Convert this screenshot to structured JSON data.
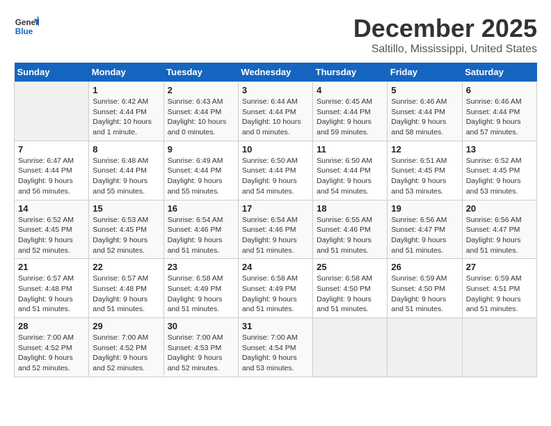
{
  "logo": {
    "line1": "General",
    "line2": "Blue"
  },
  "title": "December 2025",
  "subtitle": "Saltillo, Mississippi, United States",
  "days_header": [
    "Sunday",
    "Monday",
    "Tuesday",
    "Wednesday",
    "Thursday",
    "Friday",
    "Saturday"
  ],
  "weeks": [
    [
      {
        "num": "",
        "info": ""
      },
      {
        "num": "1",
        "info": "Sunrise: 6:42 AM\nSunset: 4:44 PM\nDaylight: 10 hours\nand 1 minute."
      },
      {
        "num": "2",
        "info": "Sunrise: 6:43 AM\nSunset: 4:44 PM\nDaylight: 10 hours\nand 0 minutes."
      },
      {
        "num": "3",
        "info": "Sunrise: 6:44 AM\nSunset: 4:44 PM\nDaylight: 10 hours\nand 0 minutes."
      },
      {
        "num": "4",
        "info": "Sunrise: 6:45 AM\nSunset: 4:44 PM\nDaylight: 9 hours\nand 59 minutes."
      },
      {
        "num": "5",
        "info": "Sunrise: 6:46 AM\nSunset: 4:44 PM\nDaylight: 9 hours\nand 58 minutes."
      },
      {
        "num": "6",
        "info": "Sunrise: 6:46 AM\nSunset: 4:44 PM\nDaylight: 9 hours\nand 57 minutes."
      }
    ],
    [
      {
        "num": "7",
        "info": "Sunrise: 6:47 AM\nSunset: 4:44 PM\nDaylight: 9 hours\nand 56 minutes."
      },
      {
        "num": "8",
        "info": "Sunrise: 6:48 AM\nSunset: 4:44 PM\nDaylight: 9 hours\nand 55 minutes."
      },
      {
        "num": "9",
        "info": "Sunrise: 6:49 AM\nSunset: 4:44 PM\nDaylight: 9 hours\nand 55 minutes."
      },
      {
        "num": "10",
        "info": "Sunrise: 6:50 AM\nSunset: 4:44 PM\nDaylight: 9 hours\nand 54 minutes."
      },
      {
        "num": "11",
        "info": "Sunrise: 6:50 AM\nSunset: 4:44 PM\nDaylight: 9 hours\nand 54 minutes."
      },
      {
        "num": "12",
        "info": "Sunrise: 6:51 AM\nSunset: 4:45 PM\nDaylight: 9 hours\nand 53 minutes."
      },
      {
        "num": "13",
        "info": "Sunrise: 6:52 AM\nSunset: 4:45 PM\nDaylight: 9 hours\nand 53 minutes."
      }
    ],
    [
      {
        "num": "14",
        "info": "Sunrise: 6:52 AM\nSunset: 4:45 PM\nDaylight: 9 hours\nand 52 minutes."
      },
      {
        "num": "15",
        "info": "Sunrise: 6:53 AM\nSunset: 4:45 PM\nDaylight: 9 hours\nand 52 minutes."
      },
      {
        "num": "16",
        "info": "Sunrise: 6:54 AM\nSunset: 4:46 PM\nDaylight: 9 hours\nand 51 minutes."
      },
      {
        "num": "17",
        "info": "Sunrise: 6:54 AM\nSunset: 4:46 PM\nDaylight: 9 hours\nand 51 minutes."
      },
      {
        "num": "18",
        "info": "Sunrise: 6:55 AM\nSunset: 4:46 PM\nDaylight: 9 hours\nand 51 minutes."
      },
      {
        "num": "19",
        "info": "Sunrise: 6:56 AM\nSunset: 4:47 PM\nDaylight: 9 hours\nand 51 minutes."
      },
      {
        "num": "20",
        "info": "Sunrise: 6:56 AM\nSunset: 4:47 PM\nDaylight: 9 hours\nand 51 minutes."
      }
    ],
    [
      {
        "num": "21",
        "info": "Sunrise: 6:57 AM\nSunset: 4:48 PM\nDaylight: 9 hours\nand 51 minutes."
      },
      {
        "num": "22",
        "info": "Sunrise: 6:57 AM\nSunset: 4:48 PM\nDaylight: 9 hours\nand 51 minutes."
      },
      {
        "num": "23",
        "info": "Sunrise: 6:58 AM\nSunset: 4:49 PM\nDaylight: 9 hours\nand 51 minutes."
      },
      {
        "num": "24",
        "info": "Sunrise: 6:58 AM\nSunset: 4:49 PM\nDaylight: 9 hours\nand 51 minutes."
      },
      {
        "num": "25",
        "info": "Sunrise: 6:58 AM\nSunset: 4:50 PM\nDaylight: 9 hours\nand 51 minutes."
      },
      {
        "num": "26",
        "info": "Sunrise: 6:59 AM\nSunset: 4:50 PM\nDaylight: 9 hours\nand 51 minutes."
      },
      {
        "num": "27",
        "info": "Sunrise: 6:59 AM\nSunset: 4:51 PM\nDaylight: 9 hours\nand 51 minutes."
      }
    ],
    [
      {
        "num": "28",
        "info": "Sunrise: 7:00 AM\nSunset: 4:52 PM\nDaylight: 9 hours\nand 52 minutes."
      },
      {
        "num": "29",
        "info": "Sunrise: 7:00 AM\nSunset: 4:52 PM\nDaylight: 9 hours\nand 52 minutes."
      },
      {
        "num": "30",
        "info": "Sunrise: 7:00 AM\nSunset: 4:53 PM\nDaylight: 9 hours\nand 52 minutes."
      },
      {
        "num": "31",
        "info": "Sunrise: 7:00 AM\nSunset: 4:54 PM\nDaylight: 9 hours\nand 53 minutes."
      },
      {
        "num": "",
        "info": ""
      },
      {
        "num": "",
        "info": ""
      },
      {
        "num": "",
        "info": ""
      }
    ]
  ]
}
